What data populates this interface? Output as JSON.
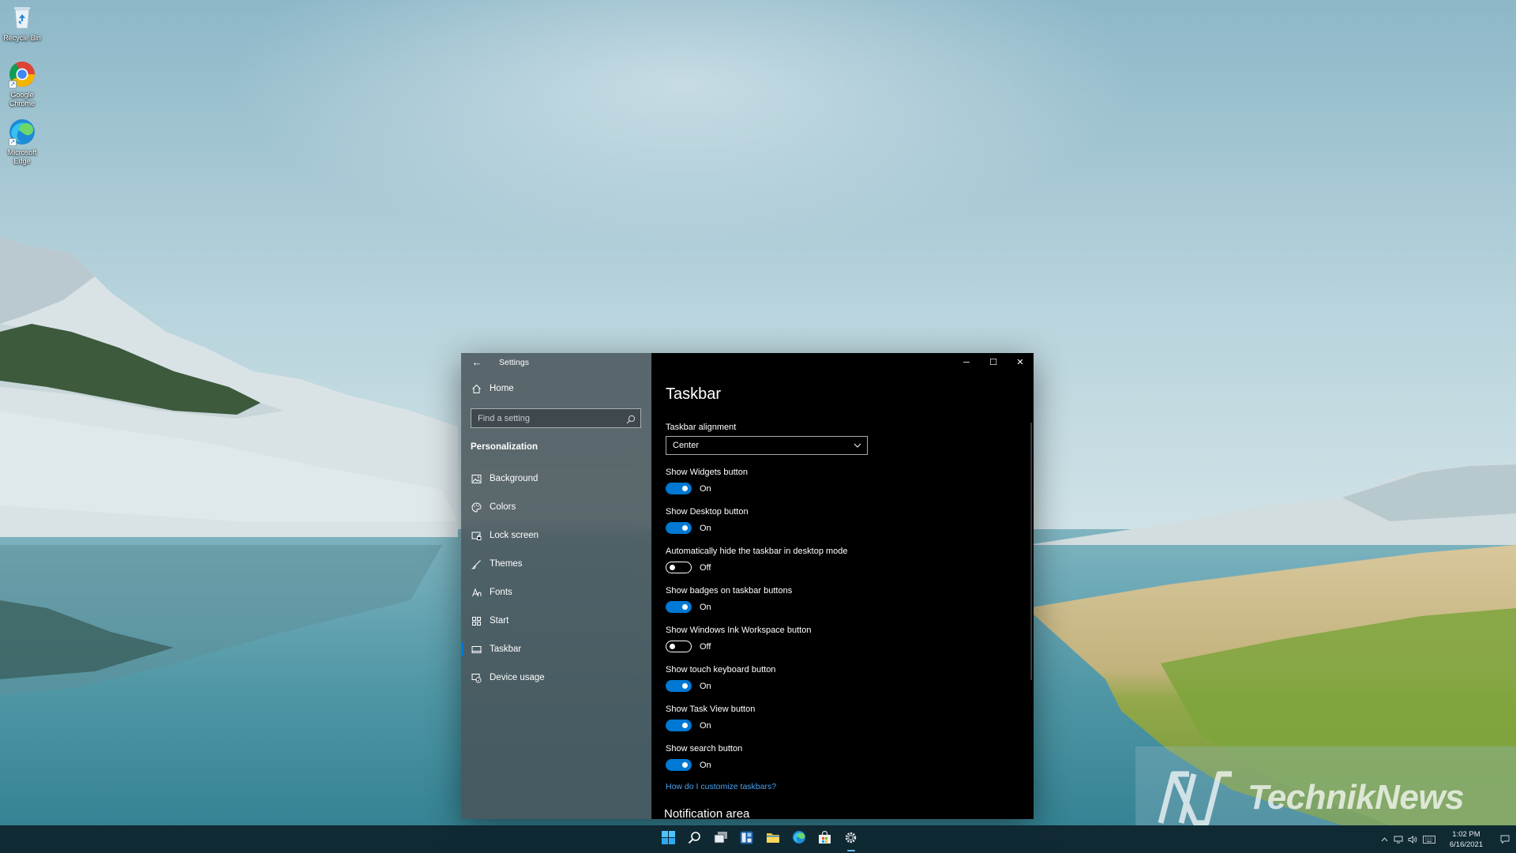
{
  "desktop": {
    "icons": [
      {
        "label": "Recycle Bin"
      },
      {
        "label": "Google Chrome"
      },
      {
        "label": "Microsoft Edge"
      }
    ]
  },
  "window": {
    "title": "Settings",
    "controls": {
      "minimize": "─",
      "maximize": "☐",
      "close": "✕"
    }
  },
  "nav": {
    "home_label": "Home",
    "search_placeholder": "Find a setting",
    "section_heading": "Personalization",
    "items": [
      {
        "label": "Background",
        "icon": "image-icon"
      },
      {
        "label": "Colors",
        "icon": "palette-icon"
      },
      {
        "label": "Lock screen",
        "icon": "lock-screen-icon"
      },
      {
        "label": "Themes",
        "icon": "brush-icon"
      },
      {
        "label": "Fonts",
        "icon": "font-icon"
      },
      {
        "label": "Start",
        "icon": "start-icon"
      },
      {
        "label": "Taskbar",
        "icon": "taskbar-icon",
        "active": true
      },
      {
        "label": "Device usage",
        "icon": "device-usage-icon"
      }
    ]
  },
  "content": {
    "page_title": "Taskbar",
    "alignment": {
      "label": "Taskbar alignment",
      "value": "Center"
    },
    "settings": [
      {
        "label": "Show Widgets button",
        "state": "On"
      },
      {
        "label": "Show Desktop button",
        "state": "On"
      },
      {
        "label": "Automatically hide the taskbar in desktop mode",
        "state": "Off"
      },
      {
        "label": "Show badges on taskbar buttons",
        "state": "On"
      },
      {
        "label": "Show Windows Ink Workspace button",
        "state": "Off"
      },
      {
        "label": "Show touch keyboard button",
        "state": "On"
      },
      {
        "label": "Show Task View button",
        "state": "On"
      },
      {
        "label": "Show search button",
        "state": "On"
      }
    ],
    "help_link": "How do I customize taskbars?",
    "next_section": "Notification area"
  },
  "watermark": {
    "text": "TechnikNews"
  },
  "taskbar": {
    "apps": [
      "start-icon",
      "search-icon",
      "task-view-icon",
      "widgets-icon",
      "file-explorer-icon",
      "edge-icon",
      "store-icon",
      "settings-gear-icon"
    ],
    "clock": {
      "time": "1:02 PM",
      "date": "6/16/2021"
    }
  },
  "colors": {
    "accent": "#0078d4",
    "link": "#4aa3f0"
  }
}
